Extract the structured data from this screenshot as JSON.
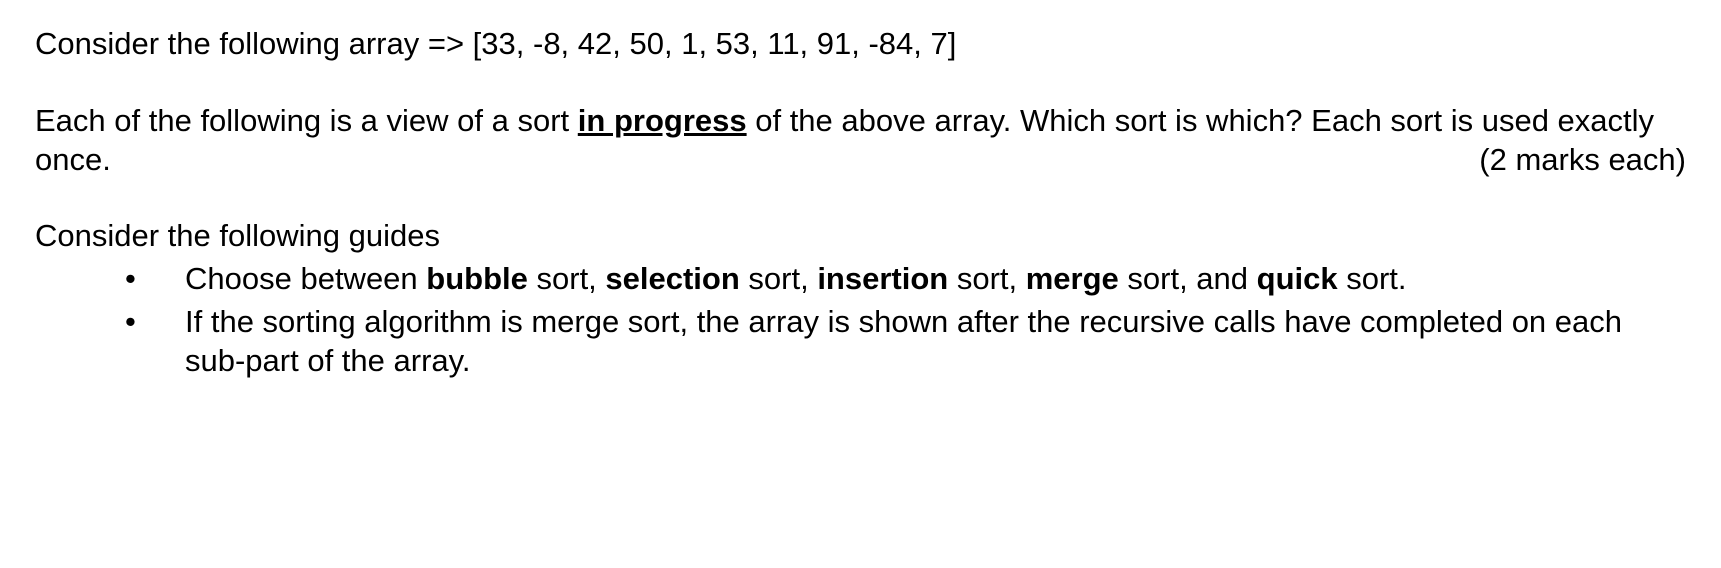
{
  "para1": "Consider the following array => [33, -8, 42, 50, 1, 53, 11, 91, -84, 7]",
  "para2": {
    "part1": "Each of the following is a view of a sort ",
    "ub": "in progress",
    "part2": " of the above array. Which sort is which? Each sort is used exactly once.",
    "marks": "(2 marks each)"
  },
  "para3": "Consider the following guides",
  "bullets": [
    {
      "segments": [
        {
          "text": "Choose between ",
          "bold": false
        },
        {
          "text": "bubble",
          "bold": true
        },
        {
          "text": " sort, ",
          "bold": false
        },
        {
          "text": "selection",
          "bold": true
        },
        {
          "text": " sort, ",
          "bold": false
        },
        {
          "text": "insertion",
          "bold": true
        },
        {
          "text": " sort, ",
          "bold": false
        },
        {
          "text": "merge",
          "bold": true
        },
        {
          "text": " sort, and ",
          "bold": false
        },
        {
          "text": "quick",
          "bold": true
        },
        {
          "text": " sort.",
          "bold": false
        }
      ]
    },
    {
      "segments": [
        {
          "text": "If the sorting algorithm is merge sort, the array is shown after the recursive calls have completed on each sub-part of the array.",
          "bold": false
        }
      ]
    }
  ]
}
